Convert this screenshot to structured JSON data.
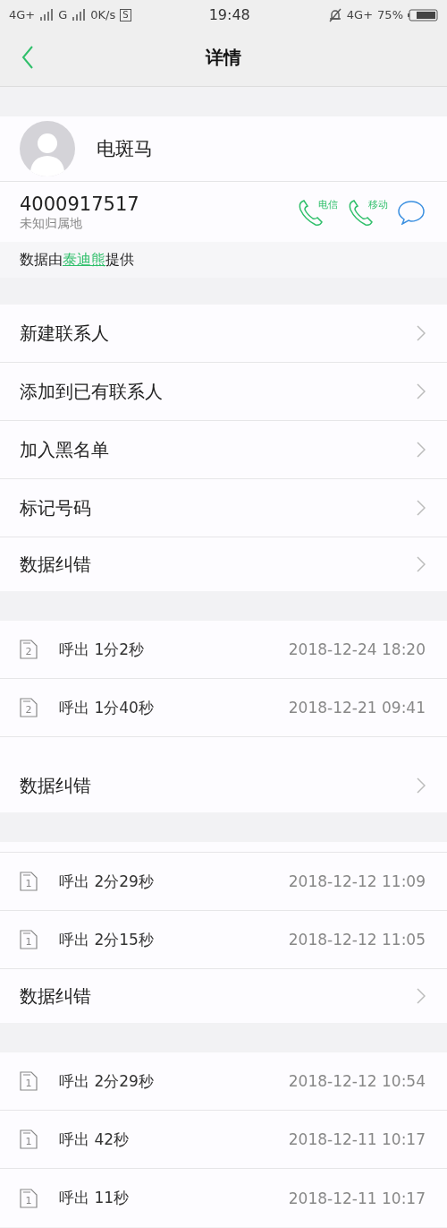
{
  "status_bar": {
    "net1": "4G+",
    "net2": "G",
    "speed": "0K/s",
    "s_badge": "S",
    "time": "19:48",
    "net3": "4G+",
    "battery": "75%"
  },
  "header": {
    "title": "详情"
  },
  "contact": {
    "name": "电斑马",
    "number": "4000917517",
    "location": "未知归属地",
    "actions": [
      {
        "kind": "call",
        "label": "电信"
      },
      {
        "kind": "call",
        "label": "移动"
      },
      {
        "kind": "message"
      }
    ]
  },
  "provider": {
    "prefix": "数据由",
    "link": "泰迪熊",
    "suffix": "提供"
  },
  "sections": [
    {
      "rows": [
        {
          "kind": "menu",
          "label": "新建联系人"
        },
        {
          "kind": "menu",
          "label": "添加到已有联系人"
        },
        {
          "kind": "menu",
          "label": "加入黑名单"
        },
        {
          "kind": "menu",
          "label": "标记号码"
        },
        {
          "kind": "menu",
          "label": "数据纠错"
        }
      ]
    },
    {
      "rows": [
        {
          "kind": "call",
          "sim": "2",
          "label": "呼出 1分2秒",
          "time": "2018-12-24 18:20"
        },
        {
          "kind": "call",
          "sim": "2",
          "label": "呼出 1分40秒",
          "time": "2018-12-21 09:41"
        },
        {
          "kind": "cut_bottom"
        },
        {
          "kind": "menu",
          "label": "数据纠错"
        }
      ]
    },
    {
      "rows": [
        {
          "kind": "cut_top"
        },
        {
          "kind": "call",
          "sim": "1",
          "label": "呼出 2分29秒",
          "time": "2018-12-12 11:09"
        },
        {
          "kind": "call",
          "sim": "1",
          "label": "呼出 2分15秒",
          "time": "2018-12-12 11:05"
        },
        {
          "kind": "menu",
          "label": "数据纠错"
        }
      ]
    },
    {
      "rows": [
        {
          "kind": "call",
          "sim": "1",
          "label": "呼出 2分29秒",
          "time": "2018-12-12 10:54"
        },
        {
          "kind": "call",
          "sim": "1",
          "label": "呼出 42秒",
          "time": "2018-12-11 10:17"
        },
        {
          "kind": "call",
          "sim": "1",
          "label": "呼出 11秒",
          "time": "2018-12-11 10:17"
        }
      ]
    }
  ]
}
